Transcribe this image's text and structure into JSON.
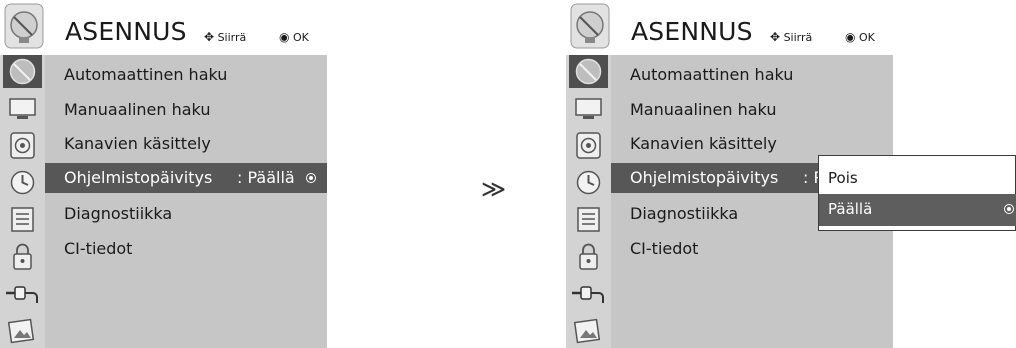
{
  "left_screen": {
    "title": "ASENNUS",
    "hint_move": "Siirrä",
    "hint_ok": "OK",
    "menu": [
      {
        "label": "Automaattinen haku"
      },
      {
        "label": "Manuaalinen haku"
      },
      {
        "label": "Kanavien käsittely"
      },
      {
        "label": "Ohjelmistopäivitys",
        "value": ": Päällä"
      },
      {
        "label": "Diagnostiikka"
      },
      {
        "label": "CI-tiedot"
      }
    ]
  },
  "arrow": "≫",
  "right_screen": {
    "title": "ASENNUS",
    "hint_move": "Siirrä",
    "hint_ok": "OK",
    "menu": [
      {
        "label": "Automaattinen haku"
      },
      {
        "label": "Manuaalinen haku"
      },
      {
        "label": "Kanavien käsittely"
      },
      {
        "label": "Ohjelmistopäivitys",
        "value": ": P"
      },
      {
        "label": "Diagnostiikka"
      },
      {
        "label": "CI-tiedot"
      }
    ],
    "popup_options": [
      {
        "label": "Pois"
      },
      {
        "label": "Päällä"
      }
    ]
  },
  "colors": {
    "panel": "#c6c6c6",
    "sidebar": "#d3d3d3",
    "selected": "#575757"
  },
  "icons": [
    "satellite-dish-icon",
    "tv-screen-icon",
    "speaker-icon",
    "clock-icon",
    "menu-list-icon",
    "lock-icon",
    "cable-plug-icon",
    "photo-icon"
  ]
}
